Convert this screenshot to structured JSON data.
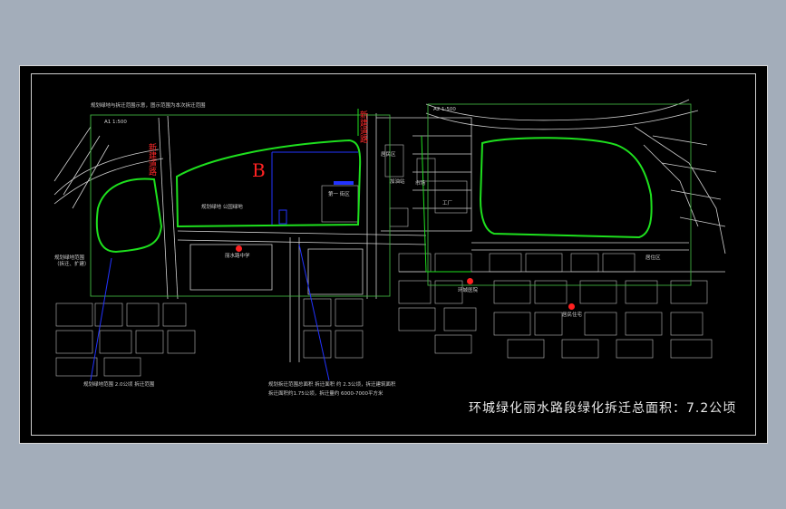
{
  "title": "环城绿化丽水路段绿化拆迁总面积：7.2公顷",
  "zone_label": "B",
  "red_labels": [
    "新建道路",
    "新建道路"
  ],
  "notes": {
    "top": "规划绿地与拆迁范围示意，图示范围为本次拆迁范围",
    "bottom_left": "规划绿地范围 2.0公顷 拆迁范围",
    "bottom_mid_1": "规划拆迁范围总面积 拆迁面积 约 2.3公顷，拆迁建筑面积",
    "bottom_mid_2": "拆迁面积约1.75公顷，拆迁量约 6000-7000平方米",
    "left_mid": "规划绿地范围（拆迁、扩建）"
  },
  "place_labels": {
    "park_mid": "规划绿地 公园绿地",
    "school": "丽水路中学",
    "hospital": "环城医院",
    "station": "加油站",
    "market": "市场",
    "factory": "工厂",
    "block1": "居民区",
    "block2": "第一 街区",
    "office": "办公楼",
    "right_corner": "居住区",
    "res_left": "居民住宅",
    "res_right": "居民住宅"
  },
  "scale_labels": [
    "A1 1:500",
    "A2 1:500"
  ],
  "colors": {
    "background": "#a3adba",
    "drawing": "#000000",
    "green_boundary": "#1ee01e",
    "frame_green": "#3fae3f",
    "blue_leader": "#2233ff",
    "red": "#ff2222",
    "linework": "#d0d0d0"
  }
}
